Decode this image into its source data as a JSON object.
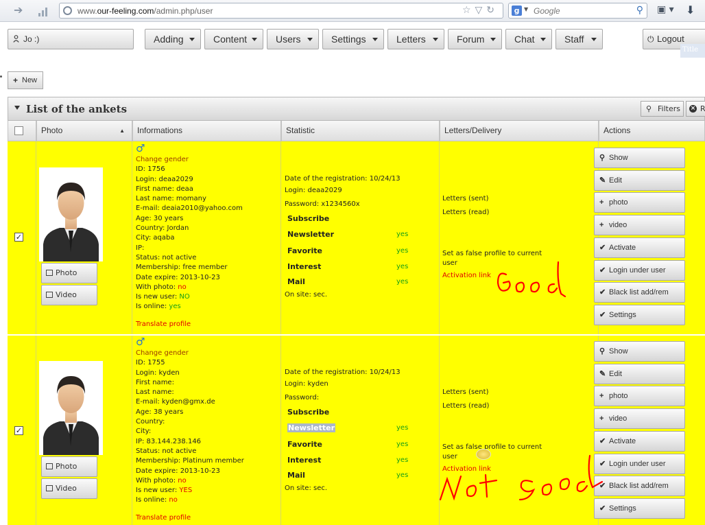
{
  "browser": {
    "url_prefix": "www.",
    "url_domain": "our-feeling.com",
    "url_path": "/admin.php/user",
    "search_placeholder": "Google",
    "search_engine_letter": "g"
  },
  "topbar": {
    "user_label": "Jo :)",
    "menus": [
      "Adding",
      "Content",
      "Users",
      "Settings",
      "Letters",
      "Forum",
      "Chat",
      "Staff"
    ],
    "logout_label": "Logout",
    "ghost_text": "Title"
  },
  "toolbar": {
    "new_label": "New"
  },
  "panel": {
    "title": "List of the ankets",
    "filters_label": "Filters",
    "reset_label": "R"
  },
  "columns": {
    "photo": "Photo",
    "informations": "Informations",
    "statistic": "Statistic",
    "letters": "Letters/Delivery",
    "actions": "Actions"
  },
  "photo_buttons": {
    "photo": "Photo",
    "video": "Video"
  },
  "actions": [
    "Show",
    "Edit",
    "photo",
    "video",
    "Activate",
    "Login under user",
    "Black list add/rem",
    "Settings"
  ],
  "colors": {
    "row_bg": "#ffff00",
    "red": "#e00000",
    "green": "#169e16",
    "scribble": "#ff0000"
  },
  "rows": [
    {
      "checked": true,
      "change_gender": "Change gender",
      "id": "ID: 1756",
      "login": "Login: deaa2029",
      "first_name": "First name: deaa",
      "last_name": "Last name: momany",
      "email": "E-mail: deaia2010@yahoo.com",
      "age": "Age: 30 years",
      "country": "Country: Jordan",
      "city": "City: aqaba",
      "ip": "IP:",
      "status": "Status: not active",
      "membership": "Membership: free member",
      "date_expire": "Date expire: 2013-10-23",
      "with_photo_label": "With photo:",
      "with_photo_value": "no",
      "is_new_label": "Is new user:",
      "is_new_value": "NO",
      "is_online_label": "Is online:",
      "is_online_value": "yes",
      "translate": "Translate profile",
      "reg_date": "Date of the registration: 10/24/13",
      "stat_login": "Login: deaa2029",
      "password": "Password: x1234560x",
      "subscribe": "Subscribe",
      "newsletter": "Newsletter",
      "newsletter_val": "yes",
      "favorite": "Favorite",
      "favorite_val": "yes",
      "interest": "Interest",
      "interest_val": "yes",
      "mail": "Mail",
      "mail_val": "yes",
      "on_site": "On site: sec.",
      "letters_sent": "Letters (sent)",
      "letters_read": "Letters (read)",
      "false_profile": "Set as false profile to current user",
      "activation_link": "Activation link",
      "handwritten": "Good"
    },
    {
      "checked": true,
      "change_gender": "Change gender",
      "id": "ID: 1755",
      "login": "Login: kyden",
      "first_name": "First name:",
      "last_name": "Last name:",
      "email": "E-mail: kyden@gmx.de",
      "age": "Age: 38 years",
      "country": "Country:",
      "city": "City:",
      "ip": "IP: 83.144.238.146",
      "status": "Status: not active",
      "membership": "Membership: Platinum member",
      "date_expire": "Date expire: 2013-10-23",
      "with_photo_label": "With photo:",
      "with_photo_value": "no",
      "is_new_label": "Is new user:",
      "is_new_value": "YES",
      "is_online_label": "Is online:",
      "is_online_value": "no",
      "translate": "Translate profile",
      "reg_date": "Date of the registration: 10/24/13",
      "stat_login": "Login: kyden",
      "password": "Password:",
      "subscribe": "Subscribe",
      "newsletter": "Newsletter",
      "newsletter_val": "yes",
      "favorite": "Favorite",
      "favorite_val": "yes",
      "interest": "Interest",
      "interest_val": "yes",
      "mail": "Mail",
      "mail_val": "yes",
      "on_site": "On site: sec.",
      "letters_sent": "Letters (sent)",
      "letters_read": "Letters (read)",
      "false_profile": "Set as false profile to current user",
      "activation_link": "Activation link",
      "handwritten": "Not good"
    }
  ]
}
